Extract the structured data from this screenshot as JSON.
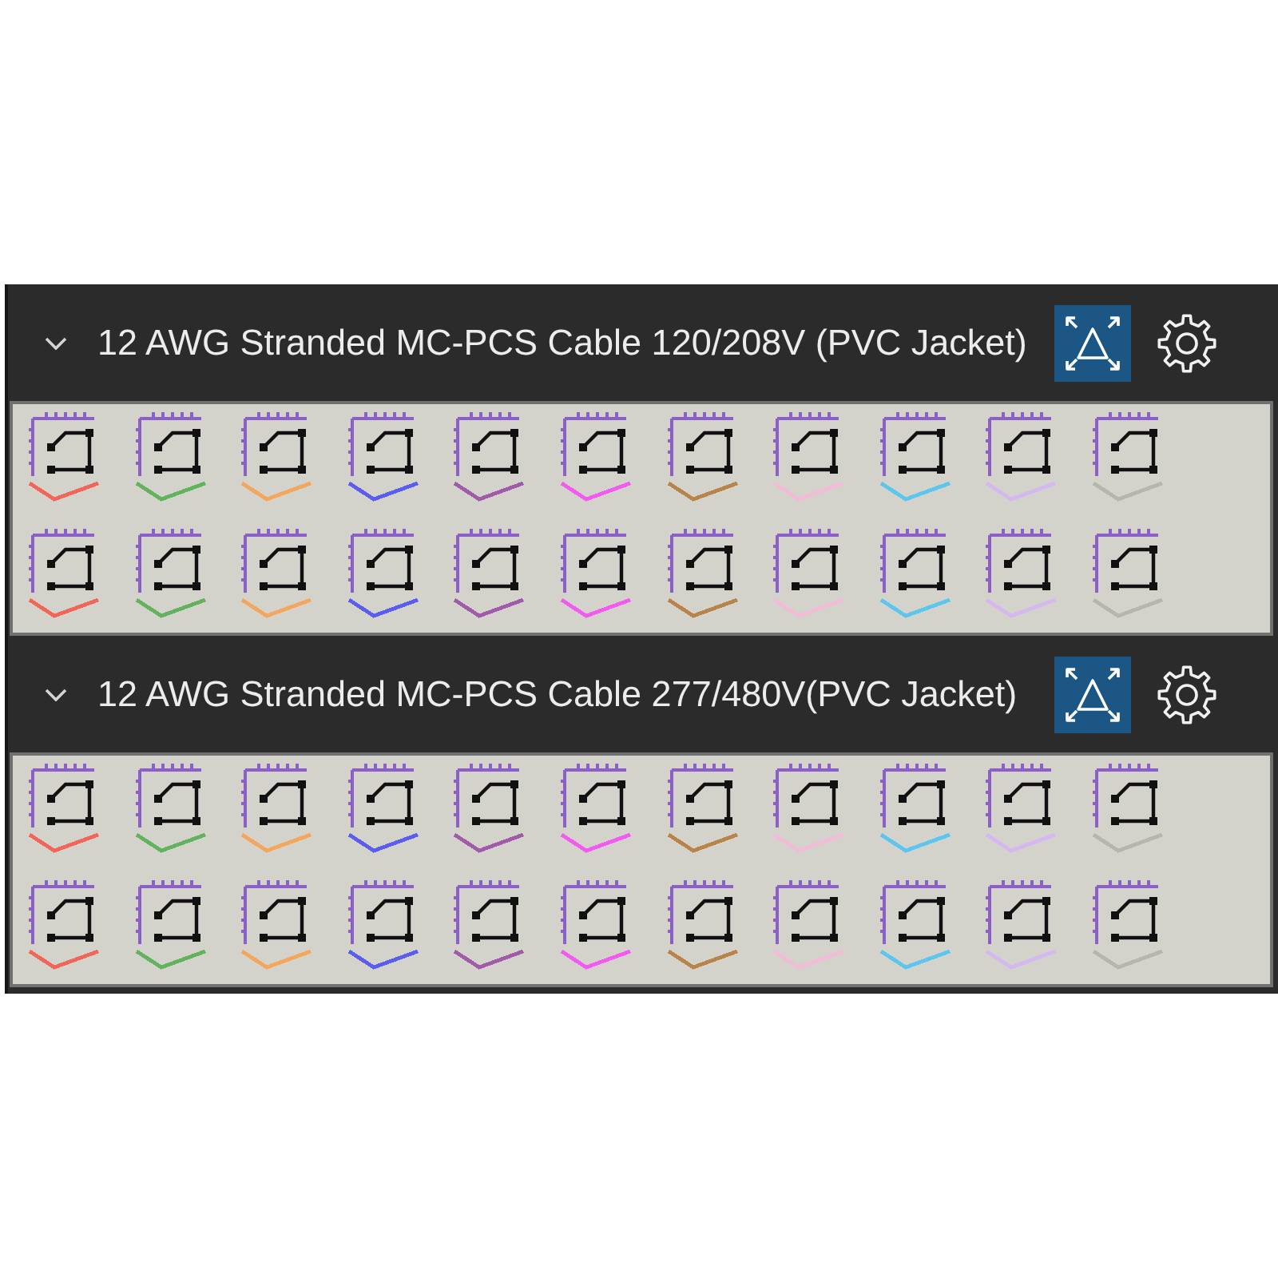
{
  "sections": [
    {
      "title": "12 AWG Stranded MC-PCS Cable 120/208V (PVC Jacket)",
      "expanded": true,
      "items": [
        {
          "color": "#f2665a"
        },
        {
          "color": "#62b25e"
        },
        {
          "color": "#f4a65c"
        },
        {
          "color": "#5a5cf2"
        },
        {
          "color": "#a05ca8"
        },
        {
          "color": "#f25af2"
        },
        {
          "color": "#b8844a"
        },
        {
          "color": "#f2bcd6"
        },
        {
          "color": "#5cc6ee"
        },
        {
          "color": "#d6b8f0"
        },
        {
          "color": "#b6b6ae"
        },
        {
          "color": "#f2665a"
        },
        {
          "color": "#62b25e"
        },
        {
          "color": "#f4a65c"
        },
        {
          "color": "#5a5cf2"
        },
        {
          "color": "#a05ca8"
        },
        {
          "color": "#f25af2"
        },
        {
          "color": "#b8844a"
        },
        {
          "color": "#f2bcd6"
        },
        {
          "color": "#5cc6ee"
        },
        {
          "color": "#d6b8f0"
        },
        {
          "color": "#b6b6ae"
        }
      ]
    },
    {
      "title": "12 AWG Stranded MC-PCS Cable 277/480V(PVC Jacket)",
      "expanded": true,
      "items": [
        {
          "color": "#f2665a"
        },
        {
          "color": "#62b25e"
        },
        {
          "color": "#f4a65c"
        },
        {
          "color": "#5a5cf2"
        },
        {
          "color": "#a05ca8"
        },
        {
          "color": "#f25af2"
        },
        {
          "color": "#b8844a"
        },
        {
          "color": "#f2bcd6"
        },
        {
          "color": "#5cc6ee"
        },
        {
          "color": "#d6b8f0"
        },
        {
          "color": "#b6b6ae"
        },
        {
          "color": "#f2665a"
        },
        {
          "color": "#62b25e"
        },
        {
          "color": "#f4a65c"
        },
        {
          "color": "#5a5cf2"
        },
        {
          "color": "#a05ca8"
        },
        {
          "color": "#f25af2"
        },
        {
          "color": "#b8844a"
        },
        {
          "color": "#f2bcd6"
        },
        {
          "color": "#5cc6ee"
        },
        {
          "color": "#d6b8f0"
        },
        {
          "color": "#b6b6ae"
        }
      ]
    }
  ]
}
